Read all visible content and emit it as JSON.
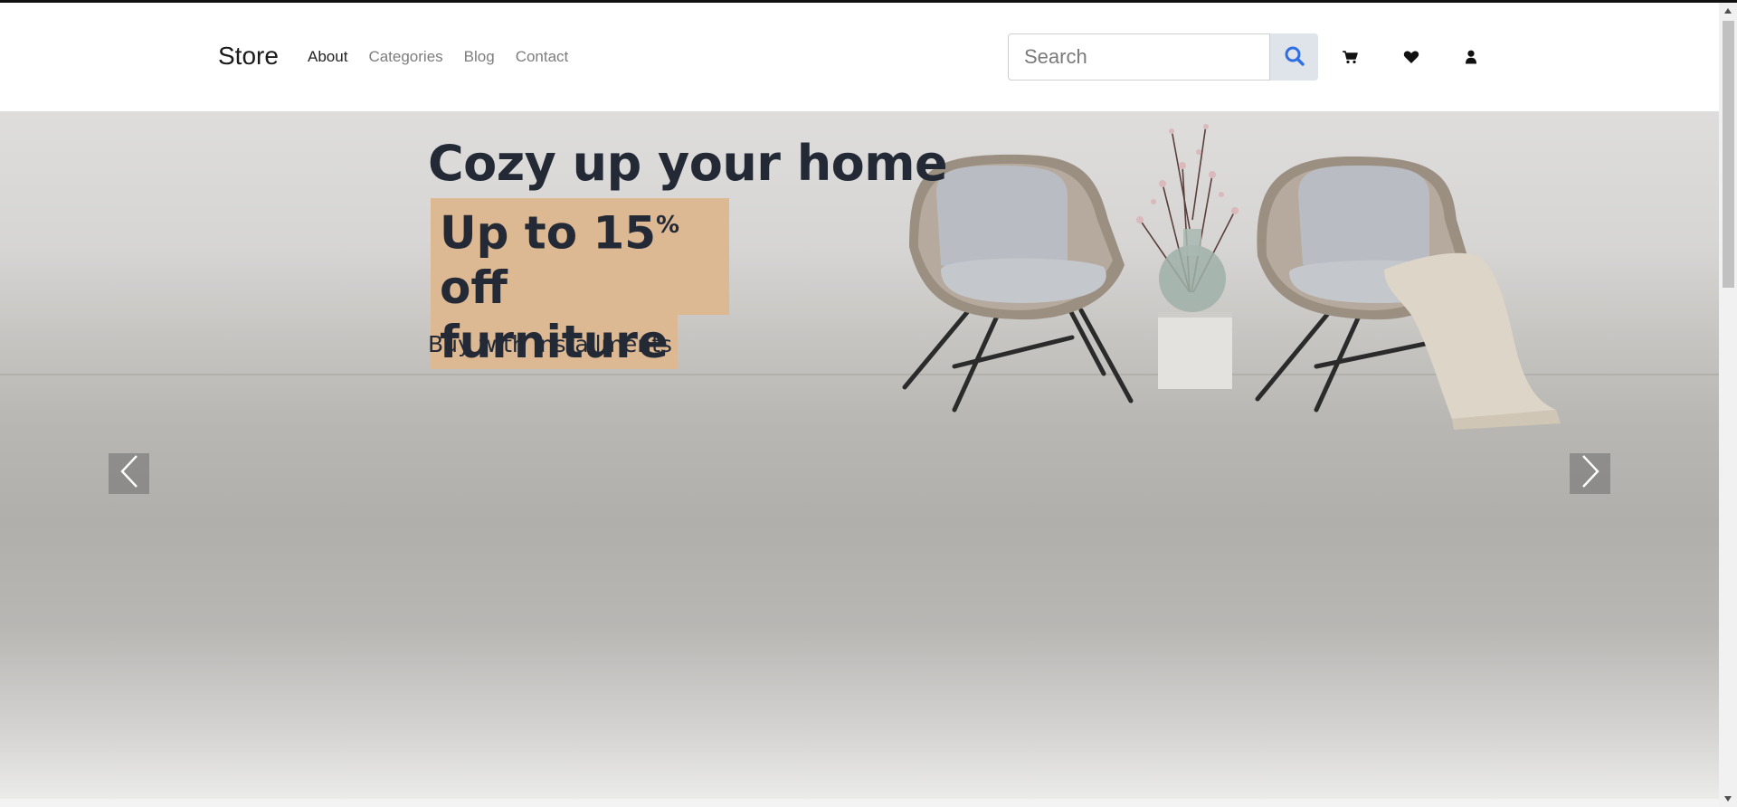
{
  "navbar": {
    "brand": "Store",
    "links": [
      "About",
      "Categories",
      "Blog",
      "Contact"
    ],
    "active_link": "About"
  },
  "search": {
    "placeholder": "Search",
    "value": ""
  },
  "header_icons": [
    "cart-icon",
    "heart-icon",
    "user-icon"
  ],
  "hero": {
    "headline": "Cozy up your home",
    "promo_line1_pre": "Up to 15",
    "promo_line1_sup": "%",
    "promo_line1_post": " off",
    "promo_line2": "furniture",
    "subline": "Buy with installments",
    "image": "Two grey woven lounge chairs with a vase of blossom branches on a marble stand",
    "highlight_color": "#dcb893",
    "text_color": "#232a36"
  },
  "carousel": {
    "prev_icon": "chevron-left-icon",
    "next_icon": "chevron-right-icon"
  },
  "colors": {
    "search_accent": "#2f6fe4",
    "search_button_bg": "#dfe4ea"
  }
}
